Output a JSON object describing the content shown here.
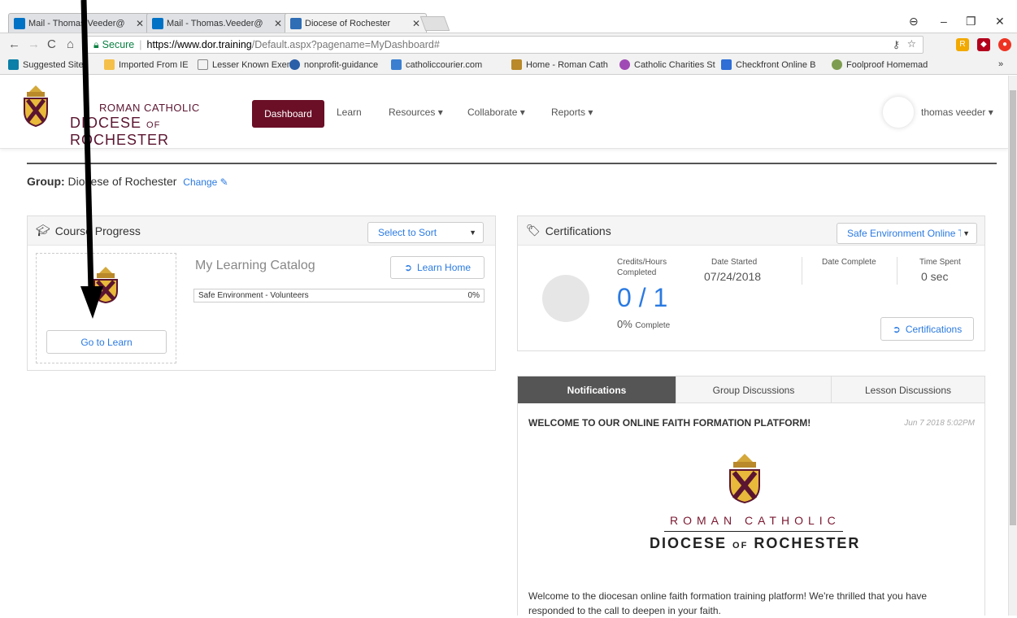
{
  "browser": {
    "tabs": [
      {
        "title": "Mail - Thomas.Veeder@",
        "icon": "outlook-icon"
      },
      {
        "title": "Mail - Thomas.Veeder@",
        "icon": "outlook-icon"
      },
      {
        "title": "Diocese of Rochester",
        "icon": "site-favicon"
      }
    ],
    "address": {
      "secure_label": "Secure",
      "host": "https://www.dor.training",
      "path": "/Default.aspx?pagename=MyDashboard#"
    },
    "bookmarks": [
      {
        "label": "Suggested Sites"
      },
      {
        "label": "Imported From IE"
      },
      {
        "label": "Lesser Known Exemp"
      },
      {
        "label": "nonprofit-guidance"
      },
      {
        "label": "catholiccourier.com"
      },
      {
        "label": "Home - Roman Cath"
      },
      {
        "label": "Catholic Charities St"
      },
      {
        "label": "Checkfront Online B"
      },
      {
        "label": "Foolproof Homemad"
      }
    ],
    "more": "»"
  },
  "header": {
    "logo_line1": "ROMAN CATHOLIC",
    "logo_line2a": "DIOCESE",
    "logo_of": "OF",
    "logo_line2b": "ROCHESTER",
    "nav": {
      "dashboard": "Dashboard",
      "learn": "Learn",
      "resources": "Resources ▾",
      "collaborate": "Collaborate ▾",
      "reports": "Reports ▾"
    },
    "user": "thomas veeder ▾"
  },
  "group": {
    "label": "Group:",
    "name": "Diocese of Rochester",
    "change": "Change"
  },
  "course_progress": {
    "title": "Course Progress",
    "sort_placeholder": "Select to Sort",
    "go_to_learn": "Go to Learn",
    "catalog_title": "My Learning Catalog",
    "learn_home": "Learn Home",
    "courses": [
      {
        "name": "Safe Environment - Volunteers",
        "progress": "0%"
      }
    ]
  },
  "certifications": {
    "title": "Certifications",
    "select": "Safe Environment Online T",
    "credits_label": "Credits/Hours Completed",
    "credits_value": "0 / 1",
    "percent": "0%",
    "percent_label": "Complete",
    "date_started_label": "Date Started",
    "date_started": "07/24/2018",
    "date_complete_label": "Date Complete",
    "time_spent_label": "Time Spent",
    "time_spent": "0 sec",
    "button": "Certifications"
  },
  "notifications": {
    "tabs": [
      "Notifications",
      "Group Discussions",
      "Lesson Discussions"
    ],
    "title": "WELCOME TO OUR ONLINE FAITH FORMATION PLATFORM!",
    "date": "Jun 7 2018 5:02PM",
    "logo_line1": "ROMAN CATHOLIC",
    "logo_line2a": "DIOCESE",
    "logo_of": "OF",
    "logo_line2b": "ROCHESTER",
    "body": "Welcome to the diocesan online faith formation training platform! We're thrilled that you have responded to the call to deepen in your faith."
  }
}
